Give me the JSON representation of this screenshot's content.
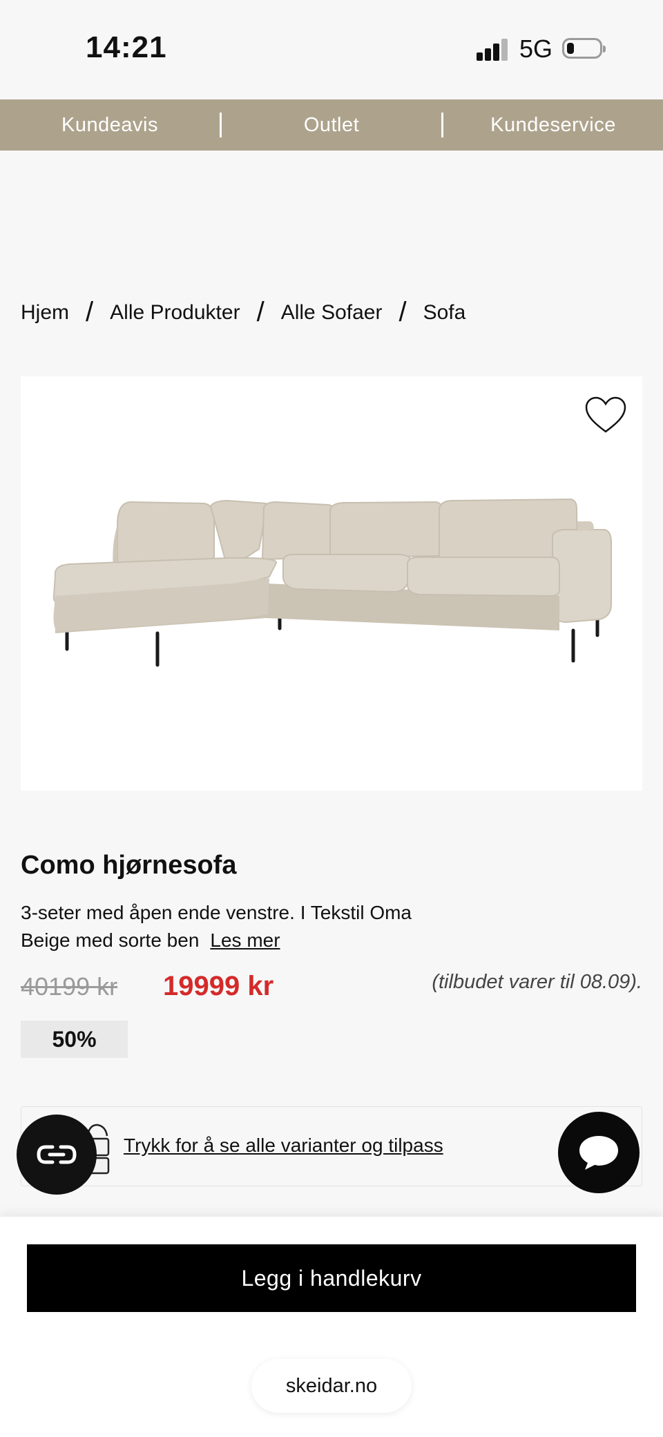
{
  "status_bar": {
    "time": "14:21",
    "network": "5G",
    "signal_icon": "cellular-signal-icon",
    "battery_icon": "battery-low-icon"
  },
  "nav": {
    "items": [
      {
        "label": "Kundeavis"
      },
      {
        "label": "Outlet"
      },
      {
        "label": "Kundeservice"
      }
    ]
  },
  "breadcrumb": {
    "items": [
      "Hjem",
      "Alle Produkter",
      "Alle Sofaer",
      "Sofa"
    ],
    "separator": "/"
  },
  "product": {
    "image_alt": "Como hjørnesofa beige with black legs",
    "favorite_icon": "heart-outline-icon",
    "title": "Como hjørnesofa",
    "description_line1": "3-seter med åpen ende venstre. I Tekstil Oma",
    "description_line2": "Beige med sorte ben",
    "read_more": "Les mer",
    "old_price": "40199 kr",
    "new_price": "19999 kr",
    "offer_note": "(tilbudet varer til 08.09).",
    "discount": "50%",
    "variants_link": "Trykk for å se alle varianter og tilpass",
    "variants_icon": "paint-bucket-icon"
  },
  "floating": {
    "co_icon": "co-badge-icon",
    "chat_icon": "chat-bubble-icon"
  },
  "cart": {
    "button_label": "Legg i handlekurv"
  },
  "browser": {
    "domain": "skeidar.no"
  },
  "colors": {
    "nav_bg": "#ada38d",
    "price_red": "#d42a2a",
    "button_black": "#000000"
  }
}
